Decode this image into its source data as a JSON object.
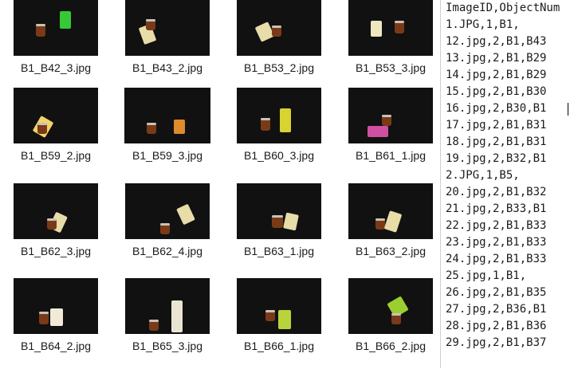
{
  "gallery": {
    "tiles": [
      {
        "file": "B1_B42_3.jpg"
      },
      {
        "file": "B1_B43_2.jpg"
      },
      {
        "file": "B1_B53_2.jpg"
      },
      {
        "file": "B1_B53_3.jpg"
      },
      {
        "file": "B1_B59_2.jpg"
      },
      {
        "file": "B1_B59_3.jpg"
      },
      {
        "file": "B1_B60_3.jpg"
      },
      {
        "file": "B1_B61_1.jpg"
      },
      {
        "file": "B1_B62_3.jpg"
      },
      {
        "file": "B1_B62_4.jpg"
      },
      {
        "file": "B1_B63_1.jpg"
      },
      {
        "file": "B1_B63_2.jpg"
      },
      {
        "file": "B1_B64_2.jpg"
      },
      {
        "file": "B1_B65_3.jpg"
      },
      {
        "file": "B1_B66_1.jpg"
      },
      {
        "file": "B1_B66_2.jpg"
      }
    ]
  },
  "editor": {
    "lines": [
      "ImageID,ObjectNum",
      "1.JPG,1,B1,",
      "12.jpg,2,B1,B43",
      "13.jpg,2,B1,B29",
      "14.jpg,2,B1,B29",
      "15.jpg,2,B1,B30",
      "16.jpg,2,B30,B1",
      "17.jpg,2,B1,B31",
      "18.jpg,2,B1,B31",
      "19.jpg,2,B32,B1",
      "2.JPG,1,B5,",
      "20.jpg,2,B1,B32",
      "21.jpg,2,B33,B1",
      "22.jpg,2,B1,B33",
      "23.jpg,2,B1,B33",
      "24.jpg,2,B1,B33",
      "25.jpg,1,B1,",
      "26.jpg,2,B1,B35",
      "27.jpg,2,B36,B1",
      "28.jpg,2,B1,B36",
      "29.jpg,2,B1,B37"
    ]
  }
}
